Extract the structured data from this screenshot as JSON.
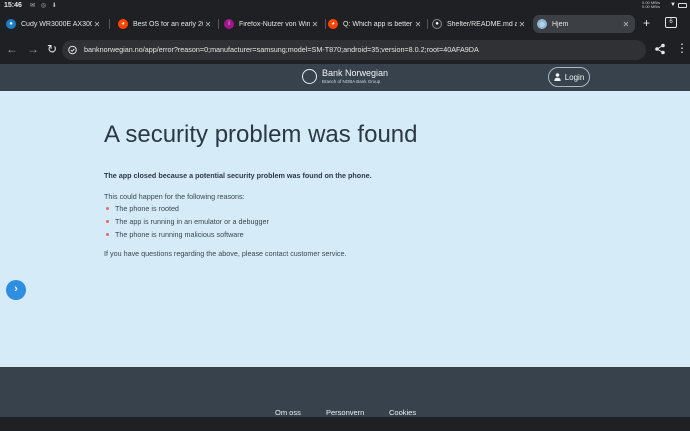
{
  "status": {
    "time": "15:46",
    "net_up": "0.00 MB/s",
    "net_down": "0.00 MB/s"
  },
  "tabs": [
    {
      "title": "Cudy WR3000E AX3000",
      "icon": "cudy-icon",
      "color": "#1e7dc8"
    },
    {
      "title": "Best OS for an early 2010",
      "icon": "reddit-icon",
      "color": "#ff4500"
    },
    {
      "title": "Firefox-Nutzer von Windows",
      "icon": "site-icon",
      "color": "#a0178c"
    },
    {
      "title": "Q: Which app is better or",
      "icon": "reddit-icon",
      "color": "#ff4500"
    },
    {
      "title": "Shelter/README.md at",
      "icon": "github-icon",
      "color": "#24292e"
    },
    {
      "title": "Hjem",
      "icon": "bank-icon",
      "color": "#8fb8d8",
      "active": true
    }
  ],
  "toolbar": {
    "url": "banknorwegian.no/app/error?reason=0;manufacturer=samsung;model=SM-T870;android=35;version=8.0.2;root=40AFA9DA",
    "tab_count": "6"
  },
  "header": {
    "brand": "Bank Norwegian",
    "subbrand": "Branch of NOBA Bank Group",
    "login_label": "Login"
  },
  "main": {
    "title": "A security problem was found",
    "lead": "The app closed because a potential security problem was found on the phone.",
    "reasons_intro": "This could happen for the following reasons:",
    "reasons": [
      "The phone is rooted",
      "The app is running in an emulator or a debugger",
      "The phone is running malicious software"
    ],
    "contact": "If you have questions regarding the above, please contact customer service."
  },
  "footer": {
    "links": [
      "Om oss",
      "Personvern",
      "Cookies"
    ]
  },
  "colors": {
    "header_bg": "#37424c",
    "main_bg": "#d5ecf8",
    "bullet": "#e06a6a",
    "fab": "#2e8ee0"
  }
}
